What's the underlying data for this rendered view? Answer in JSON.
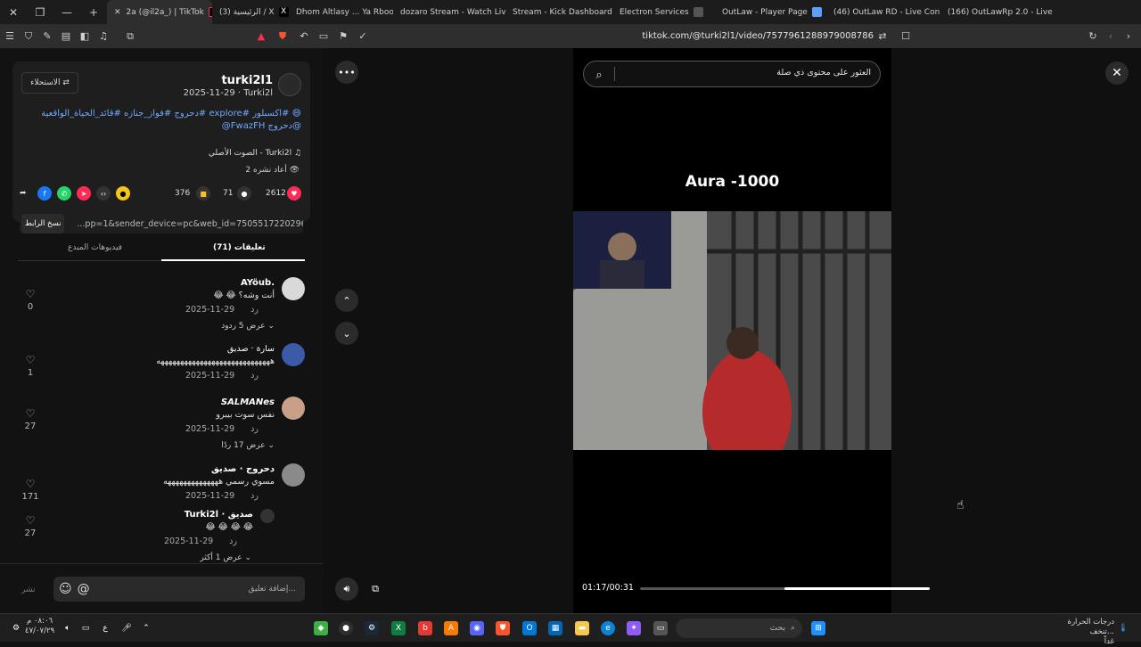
{
  "tabs": [
    {
      "label": "2a (@il2a_) | TikTok",
      "active": true,
      "color": "#fe2c55"
    },
    {
      "label": "(3) الرئيسية / X",
      "color": "#ffffff"
    },
    {
      "label": "Dhom Altlasy ... Ya Rbooe",
      "color": "#ff0000"
    },
    {
      "label": "dozaro Stream - Watch Live",
      "color": "#53fc18"
    },
    {
      "label": "Stream - Kick Dashboard",
      "color": "#53fc18"
    },
    {
      "label": "Electron Services",
      "color": "#888888"
    },
    {
      "label": "OutLaw - Player Page",
      "color": "#5aa0ff"
    },
    {
      "label": "(46) OutLaw RD - Live Con",
      "color": "#53fc18"
    },
    {
      "label": "(166) OutLawRp 2.0 - Live",
      "color": "#53fc18"
    }
  ],
  "address": {
    "url": "tiktok.com/@turki2l1/video/7577961288979008786"
  },
  "post": {
    "author": "turki2l1",
    "sub": "2025-11-29 · Turki2l",
    "follow_label": "الاستحلاء ⇄",
    "description": "😄 #اكسبلور #explore #دحروج #فواز_جنازه #قائد_الحياة_الواقعية @دحروج FwazFH@",
    "music": "الصوت الأصلي - Turki2l ♫",
    "repost": "2 أعاد نشره 👁",
    "likes": "2612",
    "comments": "71",
    "saves": "376",
    "link": "...pp=1&sender_device=pc&web_id=7505517220296132151",
    "copy_label": "نسخ الرابط",
    "tab_comments": "(71) تعليقات",
    "tab_creator": "فيديوهات المبدع"
  },
  "comments": [
    {
      "name": "AYöub.",
      "text": "أنت وشه؟ 😂 😂",
      "date": "2025-11-29",
      "reply": "رد",
      "likes": "0",
      "replies": "عرض 5 ردود ⌄",
      "color": "#d9d9d9"
    },
    {
      "name": "سارة · صديق",
      "text": "هههههههههههههههههههههههههههههه",
      "date": "2025-11-29",
      "reply": "رد",
      "likes": "1",
      "replies": "",
      "color": "#3b5ba8"
    },
    {
      "name": "SALMANes",
      "text": "نفس سوت بيبرو",
      "date": "2025-11-29",
      "reply": "رد",
      "likes": "27",
      "replies": "عرض 17 ردًا ⌄",
      "color": "#c8a08a"
    },
    {
      "name": "دحروج · صديق",
      "text": "مسوي رسمي ههههههههههههههه",
      "date": "2025-11-29",
      "reply": "رد",
      "likes": "171",
      "replies": "",
      "color": "#8a8a8a"
    },
    {
      "name": "Turki2l · صديق",
      "text": "😂 😂 😂 😂",
      "date": "2025-11-29",
      "reply": "رد",
      "likes": "27",
      "replies": "عرض 1 أكثر ⌄",
      "color": "#333333"
    }
  ],
  "comment_bar": {
    "placeholder": "إضافة تعليق...",
    "post": "نشر"
  },
  "video": {
    "search_placeholder": "العثور على محتوى ذي صلة",
    "caption": "Aura -1000",
    "time": "01:17/00:31",
    "progress": 0.6
  },
  "taskbar": {
    "search": "بحث",
    "weather": "درجات الحرارة تنخف...",
    "weather_sub": "غداً",
    "clock_time": "٠٨:٠٦ م",
    "clock_date": "٤٧/٠٧/٢٩"
  }
}
